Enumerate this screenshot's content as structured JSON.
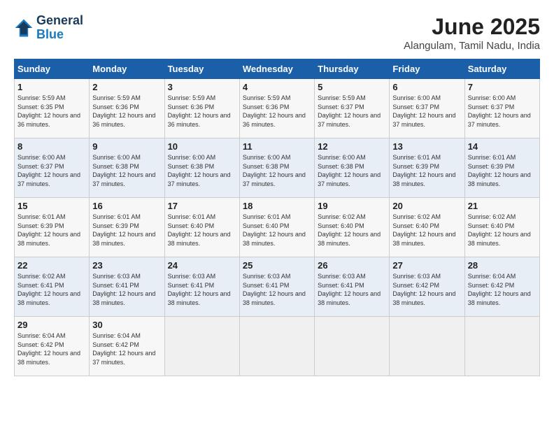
{
  "header": {
    "logo_line1": "General",
    "logo_line2": "Blue",
    "month_title": "June 2025",
    "location": "Alangulam, Tamil Nadu, India"
  },
  "weekdays": [
    "Sunday",
    "Monday",
    "Tuesday",
    "Wednesday",
    "Thursday",
    "Friday",
    "Saturday"
  ],
  "weeks": [
    [
      {
        "day": 1,
        "sunrise": "5:59 AM",
        "sunset": "6:35 PM",
        "daylight": "12 hours and 36 minutes."
      },
      {
        "day": 2,
        "sunrise": "5:59 AM",
        "sunset": "6:36 PM",
        "daylight": "12 hours and 36 minutes."
      },
      {
        "day": 3,
        "sunrise": "5:59 AM",
        "sunset": "6:36 PM",
        "daylight": "12 hours and 36 minutes."
      },
      {
        "day": 4,
        "sunrise": "5:59 AM",
        "sunset": "6:36 PM",
        "daylight": "12 hours and 36 minutes."
      },
      {
        "day": 5,
        "sunrise": "5:59 AM",
        "sunset": "6:37 PM",
        "daylight": "12 hours and 37 minutes."
      },
      {
        "day": 6,
        "sunrise": "6:00 AM",
        "sunset": "6:37 PM",
        "daylight": "12 hours and 37 minutes."
      },
      {
        "day": 7,
        "sunrise": "6:00 AM",
        "sunset": "6:37 PM",
        "daylight": "12 hours and 37 minutes."
      }
    ],
    [
      {
        "day": 8,
        "sunrise": "6:00 AM",
        "sunset": "6:37 PM",
        "daylight": "12 hours and 37 minutes."
      },
      {
        "day": 9,
        "sunrise": "6:00 AM",
        "sunset": "6:38 PM",
        "daylight": "12 hours and 37 minutes."
      },
      {
        "day": 10,
        "sunrise": "6:00 AM",
        "sunset": "6:38 PM",
        "daylight": "12 hours and 37 minutes."
      },
      {
        "day": 11,
        "sunrise": "6:00 AM",
        "sunset": "6:38 PM",
        "daylight": "12 hours and 37 minutes."
      },
      {
        "day": 12,
        "sunrise": "6:00 AM",
        "sunset": "6:38 PM",
        "daylight": "12 hours and 37 minutes."
      },
      {
        "day": 13,
        "sunrise": "6:01 AM",
        "sunset": "6:39 PM",
        "daylight": "12 hours and 38 minutes."
      },
      {
        "day": 14,
        "sunrise": "6:01 AM",
        "sunset": "6:39 PM",
        "daylight": "12 hours and 38 minutes."
      }
    ],
    [
      {
        "day": 15,
        "sunrise": "6:01 AM",
        "sunset": "6:39 PM",
        "daylight": "12 hours and 38 minutes."
      },
      {
        "day": 16,
        "sunrise": "6:01 AM",
        "sunset": "6:39 PM",
        "daylight": "12 hours and 38 minutes."
      },
      {
        "day": 17,
        "sunrise": "6:01 AM",
        "sunset": "6:40 PM",
        "daylight": "12 hours and 38 minutes."
      },
      {
        "day": 18,
        "sunrise": "6:01 AM",
        "sunset": "6:40 PM",
        "daylight": "12 hours and 38 minutes."
      },
      {
        "day": 19,
        "sunrise": "6:02 AM",
        "sunset": "6:40 PM",
        "daylight": "12 hours and 38 minutes."
      },
      {
        "day": 20,
        "sunrise": "6:02 AM",
        "sunset": "6:40 PM",
        "daylight": "12 hours and 38 minutes."
      },
      {
        "day": 21,
        "sunrise": "6:02 AM",
        "sunset": "6:40 PM",
        "daylight": "12 hours and 38 minutes."
      }
    ],
    [
      {
        "day": 22,
        "sunrise": "6:02 AM",
        "sunset": "6:41 PM",
        "daylight": "12 hours and 38 minutes."
      },
      {
        "day": 23,
        "sunrise": "6:03 AM",
        "sunset": "6:41 PM",
        "daylight": "12 hours and 38 minutes."
      },
      {
        "day": 24,
        "sunrise": "6:03 AM",
        "sunset": "6:41 PM",
        "daylight": "12 hours and 38 minutes."
      },
      {
        "day": 25,
        "sunrise": "6:03 AM",
        "sunset": "6:41 PM",
        "daylight": "12 hours and 38 minutes."
      },
      {
        "day": 26,
        "sunrise": "6:03 AM",
        "sunset": "6:41 PM",
        "daylight": "12 hours and 38 minutes."
      },
      {
        "day": 27,
        "sunrise": "6:03 AM",
        "sunset": "6:42 PM",
        "daylight": "12 hours and 38 minutes."
      },
      {
        "day": 28,
        "sunrise": "6:04 AM",
        "sunset": "6:42 PM",
        "daylight": "12 hours and 38 minutes."
      }
    ],
    [
      {
        "day": 29,
        "sunrise": "6:04 AM",
        "sunset": "6:42 PM",
        "daylight": "12 hours and 38 minutes."
      },
      {
        "day": 30,
        "sunrise": "6:04 AM",
        "sunset": "6:42 PM",
        "daylight": "12 hours and 37 minutes."
      },
      null,
      null,
      null,
      null,
      null
    ]
  ]
}
